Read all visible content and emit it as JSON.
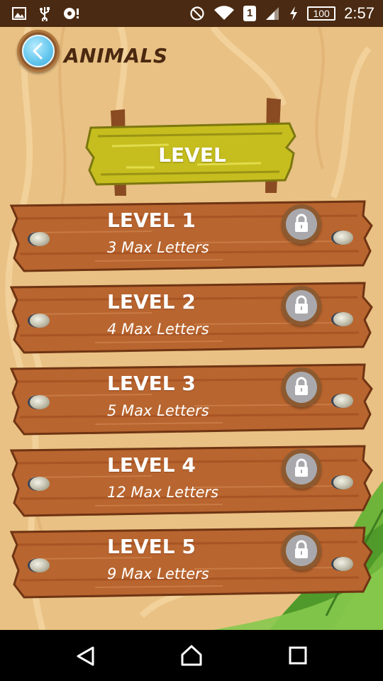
{
  "status_bar": {
    "time": "2:57",
    "battery": "100",
    "sim": "1",
    "icons": [
      "image-icon",
      "usb-icon",
      "media-icon",
      "do-not-disturb-icon",
      "wifi-icon",
      "sim-icon",
      "signal-icon",
      "charging-icon",
      "battery-icon"
    ]
  },
  "header": {
    "title": "ANIMALS",
    "back_icon": "chevron-left-icon"
  },
  "sign": {
    "title": "LEVEL"
  },
  "levels": [
    {
      "name": "LEVEL 1",
      "subtitle": "3 Max Letters",
      "locked": true
    },
    {
      "name": "LEVEL 2",
      "subtitle": "4 Max Letters",
      "locked": true
    },
    {
      "name": "LEVEL 3",
      "subtitle": "5 Max Letters",
      "locked": true
    },
    {
      "name": "LEVEL 4",
      "subtitle": "12 Max Letters",
      "locked": true
    },
    {
      "name": "LEVEL 5",
      "subtitle": "9 Max Letters",
      "locked": true
    }
  ],
  "nav": {
    "icons": [
      "back-triangle-icon",
      "home-icon",
      "recents-square-icon"
    ]
  },
  "colors": {
    "background": "#e9c184",
    "status_bar": "#4a2a12",
    "plank": "#b8652f",
    "sign": "#c9c21f",
    "title_text": "#4b2810"
  }
}
